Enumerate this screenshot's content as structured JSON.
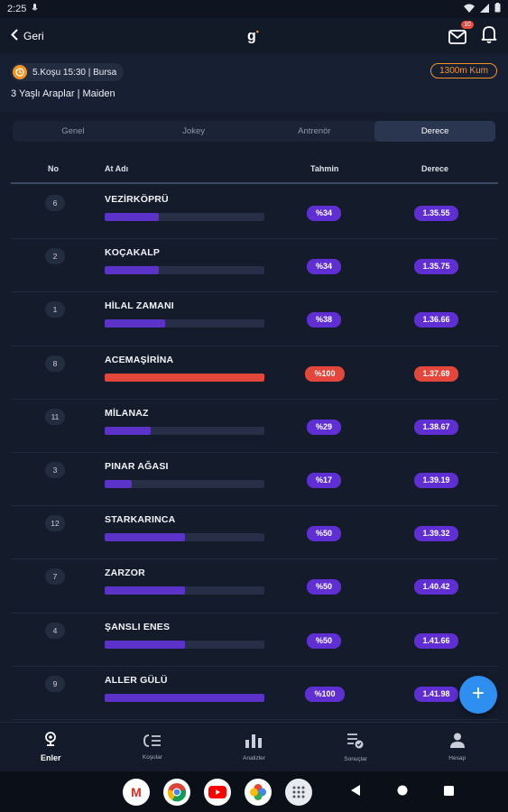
{
  "status": {
    "time": "2:25"
  },
  "header": {
    "back_label": "Geri",
    "logo": "g",
    "mail_badge": "10"
  },
  "race": {
    "info": "5.Koşu 15:30 | Bursa",
    "track": "1300m Kum",
    "title": "3 Yaşlı Araplar | Maiden"
  },
  "tabs": [
    {
      "label": "Genel"
    },
    {
      "label": "Jokey"
    },
    {
      "label": "Antrenör"
    },
    {
      "label": "Derece"
    }
  ],
  "table": {
    "headers": {
      "no": "No",
      "name": "At Adı",
      "pred": "Tahmin",
      "deg": "Derece"
    },
    "rows": [
      {
        "no": "6",
        "name": "VEZİRKÖPRÜ",
        "pred": "%34",
        "deg": "1.35.55",
        "pct": 34,
        "hl": false
      },
      {
        "no": "2",
        "name": "KOÇAKALP",
        "pred": "%34",
        "deg": "1.35.75",
        "pct": 34,
        "hl": false
      },
      {
        "no": "1",
        "name": "HİLAL ZAMANI",
        "pred": "%38",
        "deg": "1.36.66",
        "pct": 38,
        "hl": false
      },
      {
        "no": "8",
        "name": "ACEMAŞİRİNA",
        "pred": "%100",
        "deg": "1.37.69",
        "pct": 100,
        "hl": true
      },
      {
        "no": "11",
        "name": "MİLANAZ",
        "pred": "%29",
        "deg": "1.38.67",
        "pct": 29,
        "hl": false
      },
      {
        "no": "3",
        "name": "PINAR AĞASI",
        "pred": "%17",
        "deg": "1.39.19",
        "pct": 17,
        "hl": false
      },
      {
        "no": "12",
        "name": "STARKARINCA",
        "pred": "%50",
        "deg": "1.39.32",
        "pct": 50,
        "hl": false
      },
      {
        "no": "7",
        "name": "ZARZOR",
        "pred": "%50",
        "deg": "1.40.42",
        "pct": 50,
        "hl": false
      },
      {
        "no": "4",
        "name": "ŞANSLI ENES",
        "pred": "%50",
        "deg": "1.41.66",
        "pct": 50,
        "hl": false
      },
      {
        "no": "9",
        "name": "ALLER GÜLÜ",
        "pred": "%100",
        "deg": "1.41.98",
        "pct": 100,
        "hl": false
      }
    ]
  },
  "fab": {
    "label": "+"
  },
  "bottomnav": [
    {
      "label": "Enler",
      "icon": "trophy-icon"
    },
    {
      "label": "Koşular",
      "icon": "list-icon"
    },
    {
      "label": "Analizler",
      "icon": "bar-chart-icon"
    },
    {
      "label": "Sonuçlar",
      "icon": "results-icon"
    },
    {
      "label": "Hesap",
      "icon": "user-icon"
    }
  ],
  "colors": {
    "accent": "#5f2fd3",
    "highlight": "#e3463a",
    "track": "#f39422",
    "fab": "#2f8ff0"
  }
}
